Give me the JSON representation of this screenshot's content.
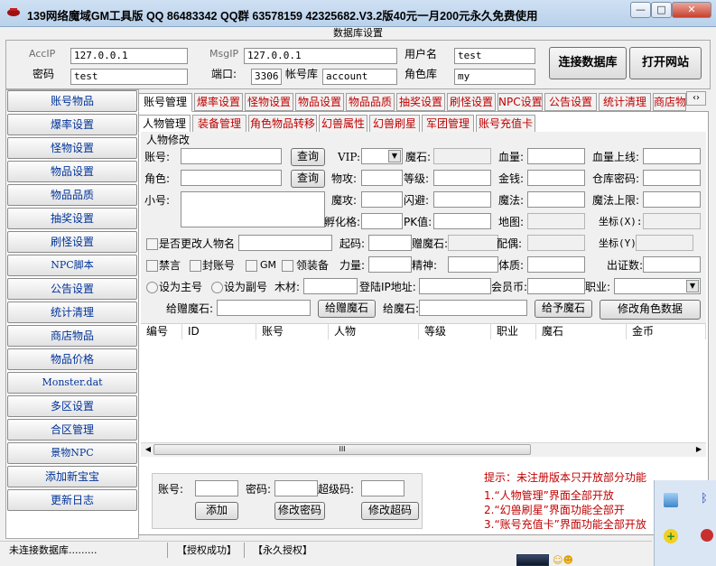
{
  "window": {
    "title": "139网络魔域GM工具版 QQ 86483342 QQ群 63578159 42325682.V3.2版40元一月200元永久免费使用",
    "min": "—",
    "max": "□",
    "close": "✕"
  },
  "db": {
    "section_title": "数据库设置",
    "acc_ip_label": "AccIP",
    "acc_ip": "127.0.0.1",
    "msg_ip_label": "MsgIP",
    "msg_ip": "127.0.0.1",
    "user_label": "用户名",
    "user": "test",
    "password_label": "密码",
    "password": "test",
    "port_label": "端口:",
    "port": "3306",
    "account_db_label": "帐号库",
    "account_db": "account",
    "role_db_label": "角色库",
    "role_db": "my",
    "connect_btn": "连接数据库",
    "open_site_btn": "打开网站"
  },
  "sidebar": [
    "账号物品",
    "爆率设置",
    "怪物设置",
    "物品设置",
    "物品品质",
    "抽奖设置",
    "刷怪设置",
    "NPC脚本",
    "公告设置",
    "统计清理",
    "商店物品",
    "物品价格",
    "Monster.dat",
    "多区设置",
    "合区管理",
    "景物NPC",
    "添加新宝宝",
    "更新日志"
  ],
  "tabs": [
    "账号管理",
    "爆率设置",
    "怪物设置",
    "物品设置",
    "物品品质",
    "抽奖设置",
    "刷怪设置",
    "NPC设置",
    "公告设置",
    "统计清理",
    "商店物品"
  ],
  "subtabs": [
    "人物管理",
    "装备管理",
    "角色物品转移",
    "幻兽属性",
    "幻兽刷星",
    "军团管理",
    "账号充值卡"
  ],
  "form": {
    "group_title": "人物修改",
    "account": "账号:",
    "query1": "查询",
    "vip": "VIP:",
    "magic_stone": "魔石:",
    "hp": "血量:",
    "hp_max": "血量上线:",
    "role": "角色:",
    "query2": "查询",
    "phys_atk": "物攻:",
    "level": "等级:",
    "gold": "金钱:",
    "warehouse_pwd": "仓库密码:",
    "alt": "小号:",
    "magic_atk": "魔攻:",
    "dodge": "闪避:",
    "mana": "魔法:",
    "mana_max": "魔法上限:",
    "hatch": "孵化格:",
    "pk": "PK值:",
    "map": "地图:",
    "coord_x": "坐标(X):",
    "change_name": "是否更改人物名",
    "start_code": "起码:",
    "gift_stone": "赠魔石:",
    "spouse": "配偶:",
    "coord_y": "坐标(Y):",
    "ban": "禁言",
    "ban_account": "封账号",
    "gm": "GM",
    "equip": "领装备",
    "strength": "力量:",
    "spirit": "精神:",
    "physique": "体质:",
    "appear_count": "出证数:",
    "set_main": "设为主号",
    "set_sub": "设为副号",
    "wood": "木材:",
    "login_ip": "登陆IP地址:",
    "member_coin": "会员币:",
    "job": "职业:",
    "gift_stone2": "给赠魔石:",
    "gift_stone_btn": "给赠魔石",
    "give_stone": "给魔石:",
    "give_stone_btn": "给予魔石",
    "modify_btn": "修改角色数据"
  },
  "table": {
    "columns": [
      "编号",
      "ID",
      "账号",
      "人物",
      "等级",
      "职业",
      "魔石",
      "金币"
    ],
    "scroll_label": "III"
  },
  "add_panel": {
    "account": "账号:",
    "password": "密码:",
    "super_code": "超级码:",
    "add_btn": "添加",
    "modify_pwd_btn": "修改密码",
    "modify_code_btn": "修改超码"
  },
  "hints": [
    "提示：未注册版本只开放部分功能",
    "1.“人物管理”界面全部开放",
    "2.“幻兽刷星”界面功能全部开",
    "3.“账号充值卡”界面功能全部开放"
  ],
  "status": {
    "connection": "未连接数据库.........",
    "auth": "【授权成功】",
    "perm": "【永久授权】"
  },
  "colors": {
    "accent_text": "#c00000",
    "nav_text": "#003399",
    "title_bar": "#c3d8ee"
  },
  "icons": [
    "app-icon",
    "tray-monitor-icon",
    "bluetooth-icon",
    "add-icon",
    "record-icon",
    "avatar-thumbnail",
    "smiley-icon"
  ]
}
